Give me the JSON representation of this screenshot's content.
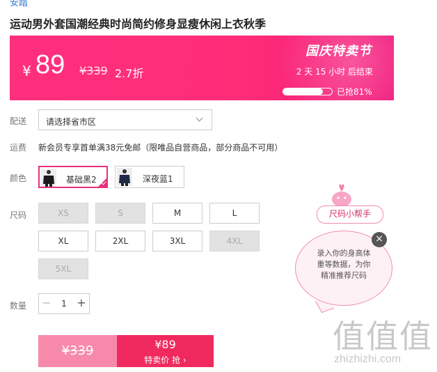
{
  "product": {
    "brand": "安踏",
    "title": "运动男外套国潮经典时尚简约修身显瘦休闲上衣秋季"
  },
  "banner": {
    "currency_symbol": "¥",
    "price": "89",
    "original_price": "¥339",
    "discount": "2.7折",
    "festival": "国庆特卖节",
    "countdown": "2 天 15 小时 后结束",
    "sold_progress": 0.81,
    "sold_text": "已抢81%",
    "gradient_start": "#ff2f7e",
    "gradient_end": "#f0197a"
  },
  "delivery": {
    "label": "配送",
    "placeholder": "请选择省市区"
  },
  "shipping": {
    "label": "运费",
    "text": "新会员专享首单满38元免邮（限唯品自营商品，部分商品不可用）"
  },
  "color": {
    "label": "颜色",
    "options": [
      {
        "name": "基础黑2",
        "selected": true
      },
      {
        "name": "深夜蓝1",
        "selected": false
      }
    ]
  },
  "size": {
    "label": "尺码",
    "options": [
      {
        "name": "XS",
        "available": false
      },
      {
        "name": "S",
        "available": false
      },
      {
        "name": "M",
        "available": true
      },
      {
        "name": "L",
        "available": true
      },
      {
        "name": "XL",
        "available": true
      },
      {
        "name": "2XL",
        "available": true
      },
      {
        "name": "3XL",
        "available": true
      },
      {
        "name": "4XL",
        "available": false
      },
      {
        "name": "5XL",
        "available": false
      }
    ]
  },
  "quantity": {
    "label": "数量",
    "minus": "−",
    "value": "1",
    "plus": "+"
  },
  "buy": {
    "original_price": "¥339",
    "price": "¥89",
    "action": "特卖价 抢",
    "arrow": "›",
    "accent": "#f0295f"
  },
  "helper": {
    "tag": "尺码小帮手",
    "line1": "录入你的身高体",
    "line2": "重等数据，为你",
    "line3": "精准推荐尺码",
    "close": "×"
  },
  "watermark": {
    "big": "值值值",
    "small": "zhizhizhi.com"
  }
}
